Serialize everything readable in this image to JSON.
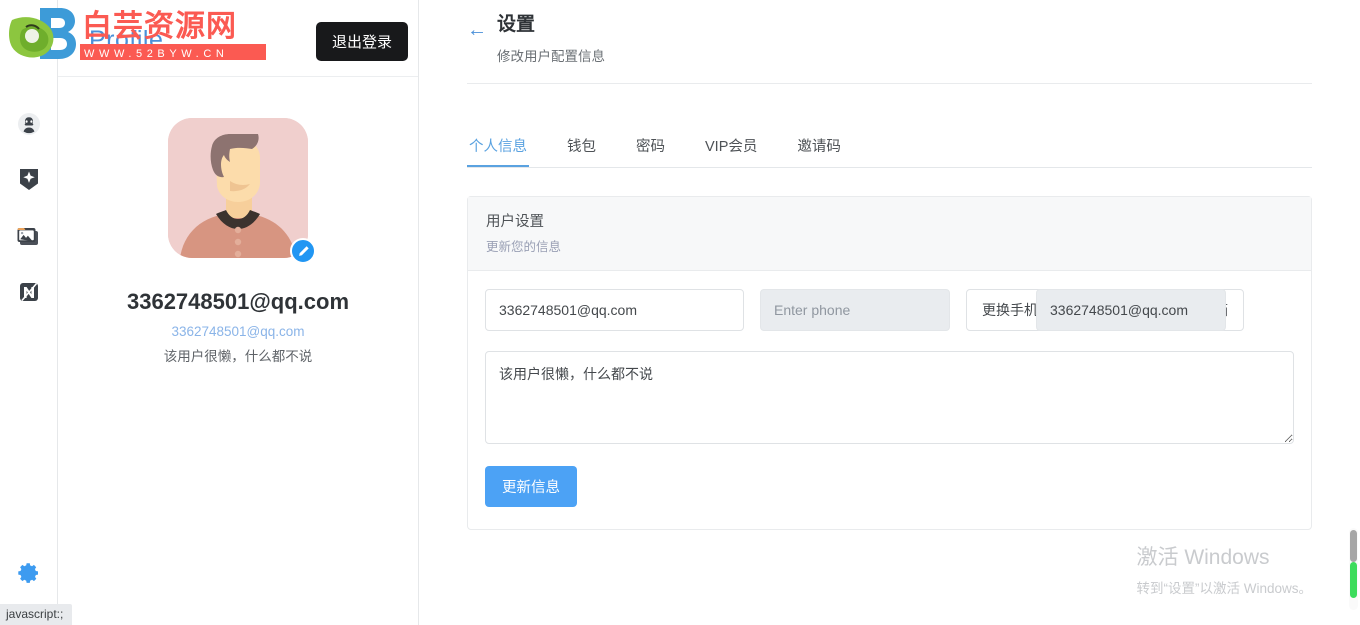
{
  "brand": {
    "logo_alt": "site-logo",
    "watermark_title": "白芸资源网",
    "watermark_url": "W W W . 5 2 B Y W . C N"
  },
  "rail": {
    "items": [
      {
        "name": "user-avatar-icon",
        "label": "用户"
      },
      {
        "name": "sparkle-badge-icon",
        "label": "推荐"
      },
      {
        "name": "photos-gallery-icon",
        "label": "图库"
      },
      {
        "name": "app-logo-icon",
        "label": "应用"
      }
    ],
    "bottom": {
      "name": "gear-icon",
      "label": "设置"
    }
  },
  "profile": {
    "title": "Profile",
    "logout_label": "退出登录",
    "name": "3362748501@qq.com",
    "email": "3362748501@qq.com",
    "bio": "该用户很懒，什么都不说",
    "edit_badge_label": "编辑头像"
  },
  "page": {
    "back_label": "←",
    "title": "设置",
    "subtitle": "修改用户配置信息"
  },
  "tabs": [
    {
      "label": "个人信息",
      "active": true
    },
    {
      "label": "钱包",
      "active": false
    },
    {
      "label": "密码",
      "active": false
    },
    {
      "label": "VIP会员",
      "active": false
    },
    {
      "label": "邀请码",
      "active": false
    }
  ],
  "card": {
    "title": "用户设置",
    "subtitle": "更新您的信息",
    "email_value": "3362748501@qq.com",
    "phone_placeholder": "Enter phone",
    "phone_value": "",
    "change_phone_label": "更换手机",
    "email2_value": "3362748501@qq.com",
    "change_email_label": "更换邮箱",
    "bio_value": "该用户很懒，什么都不说",
    "submit_label": "更新信息"
  },
  "windows_watermark": {
    "line1": "激活 Windows",
    "line2": "转到“设置”以激活 Windows。"
  },
  "statusbar": {
    "text": "javascript:;"
  },
  "colors": {
    "accent": "#4ca2f5",
    "tab_active": "#5aa2e0",
    "logout_bg": "#18191b",
    "avatar_bg": "#f0cfcd",
    "watermark_red": "#fb5a52",
    "scroll_green": "#3ddc5c"
  }
}
